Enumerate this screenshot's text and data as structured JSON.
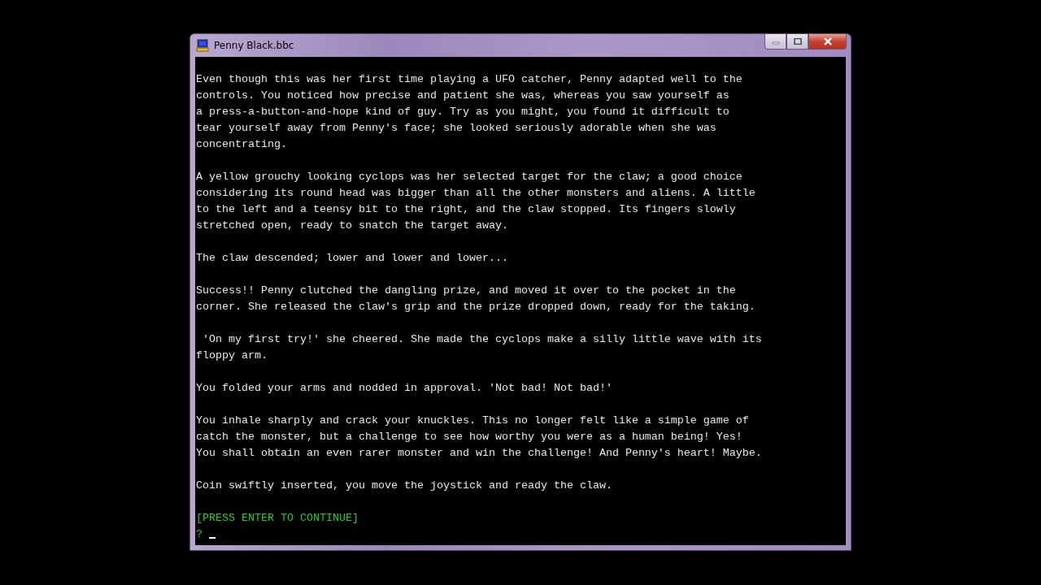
{
  "window": {
    "title": "Penny Black.bbc"
  },
  "paragraphs": [
    {
      "lines": [
        "Even though this was her first time playing a UFO catcher, Penny adapted well to the",
        "controls. You noticed how precise and patient she was, whereas you saw yourself as",
        "a press-a-button-and-hope kind of guy. Try as you might, you found it difficult to",
        "tear yourself away from Penny's face; she looked seriously adorable when she was",
        "concentrating."
      ]
    },
    {
      "lines": [
        "A yellow grouchy looking cyclops was her selected target for the claw; a good choice",
        "considering its round head was bigger than all the other monsters and aliens. A little",
        "to the left and a teensy bit to the right, and the claw stopped. Its fingers slowly",
        "stretched open, ready to snatch the target away."
      ]
    },
    {
      "lines": [
        "The claw descended; lower and lower and lower..."
      ]
    },
    {
      "lines": [
        "Success!! Penny clutched the dangling prize, and moved it over to the pocket in the",
        "corner. She released the claw's grip and the prize dropped down, ready for the taking."
      ]
    },
    {
      "lines": [
        " 'On my first try!' she cheered. She made the cyclops make a silly little wave with its",
        "floppy arm."
      ]
    },
    {
      "lines": [
        "You folded your arms and nodded in approval. 'Not bad! Not bad!'"
      ]
    },
    {
      "lines": [
        "You inhale sharply and crack your knuckles. This no longer felt like a simple game of",
        "catch the monster, but a challenge to see how worthy you were as a human being! Yes!",
        "You shall obtain an even rarer monster and win the challenge! And Penny's heart! Maybe."
      ]
    },
    {
      "lines": [
        "Coin swiftly inserted, you move the joystick and ready the claw."
      ]
    }
  ],
  "continue_prompt": "[PRESS ENTER TO CONTINUE]",
  "input_prompt": "?"
}
